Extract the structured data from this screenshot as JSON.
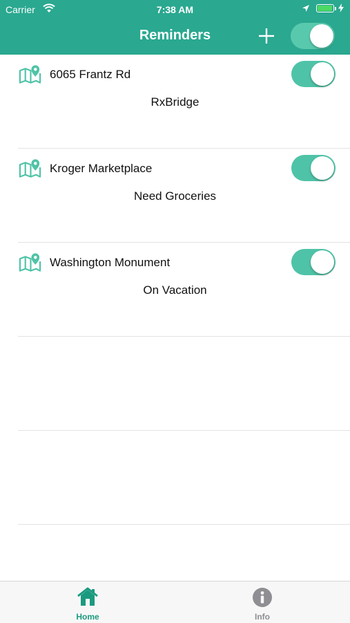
{
  "status_bar": {
    "carrier": "Carrier",
    "time": "7:38 AM"
  },
  "nav": {
    "title": "Reminders",
    "add_icon": "plus-icon",
    "master_toggle_on": true
  },
  "reminders": [
    {
      "name": "6065 Frantz Rd",
      "note": "RxBridge",
      "enabled": true,
      "icon": "map-pin-icon"
    },
    {
      "name": "Kroger Marketplace",
      "note": "Need Groceries",
      "enabled": true,
      "icon": "map-pin-icon"
    },
    {
      "name": "Washington Monument",
      "note": "On Vacation",
      "enabled": true,
      "icon": "map-pin-icon"
    }
  ],
  "tabbar": {
    "home_label": "Home",
    "info_label": "Info",
    "active_color": "#1b9a7f",
    "inactive_color": "#8e8e93"
  },
  "colors": {
    "brand": "#2aa890",
    "toggle_on": "#4fc3a7"
  }
}
